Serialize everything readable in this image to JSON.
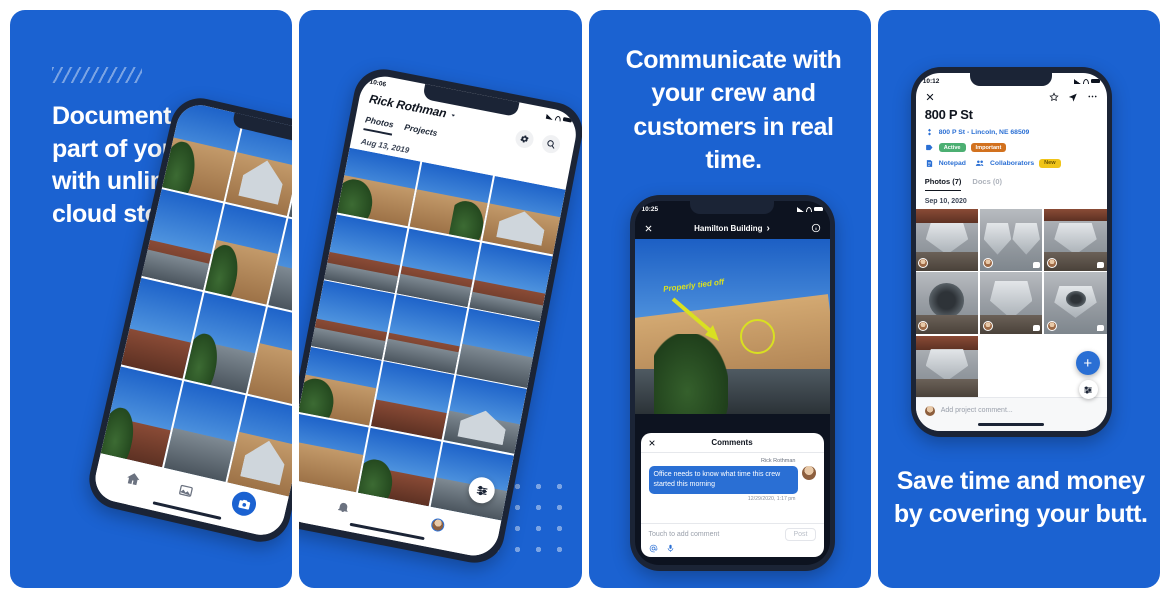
{
  "theme": {
    "brand_blue": "#1B62D1",
    "accent_blue": "#2A6FD4",
    "dark_navy": "#1B2436",
    "annotation_yellow": "#D9E021"
  },
  "panels": [
    {
      "id": "panel-1",
      "headline": "Document every part of your jobs with unlimited cloud storage.",
      "phone": {
        "nav": {
          "home": "home-icon",
          "gallery": "gallery-icon",
          "camera": "camera-button"
        }
      }
    },
    {
      "id": "panel-2",
      "phone": {
        "status": {
          "time": "10:06"
        },
        "user_name": "Rick Rothman",
        "tools": {
          "settings": "gear-icon",
          "search": "search-icon"
        },
        "tabs": [
          {
            "label": "Photos",
            "active": true
          },
          {
            "label": "Projects",
            "active": false
          }
        ],
        "date_header": "Aug 13, 2019",
        "filter": "filter-button",
        "nav": {
          "bell": "bell-icon",
          "avatar": "user-avatar"
        }
      }
    },
    {
      "id": "panel-3",
      "headline": "Communicate with your crew and customers in real time.",
      "phone": {
        "status": {
          "time": "10:25"
        },
        "topbar": {
          "close": "close-icon",
          "title": "Hamilton Building",
          "chevron": "›",
          "info": "info-icon"
        },
        "photo_annotation": "Properly tied off",
        "comments": {
          "title": "Comments",
          "close": "close-icon",
          "author": "Rick Rothman",
          "message": "Office needs to know what time this crew started this morning",
          "timestamp": "12/29/2020, 1:17 pm",
          "input_placeholder": "Touch to add comment",
          "post_label": "Post",
          "icons": [
            "mention-icon",
            "microphone-icon"
          ]
        }
      }
    },
    {
      "id": "panel-4",
      "headline": "Save time and money by covering your butt.",
      "phone": {
        "status": {
          "time": "10:12"
        },
        "actions": {
          "close": "close-icon",
          "star": "star-icon",
          "share": "send-icon",
          "more": "more-icon"
        },
        "title": "800 P St",
        "address": "800 P St - Lincoln, NE 68509",
        "tags": [
          {
            "label": "Active",
            "color": "#4CAF72"
          },
          {
            "label": "Important",
            "color": "#D2711E"
          }
        ],
        "notepad_label": "Notepad",
        "collaborators_label": "Collaborators",
        "new_badge": "New",
        "tabs": [
          {
            "label": "Photos (7)",
            "active": true
          },
          {
            "label": "Docs (0)",
            "active": false
          }
        ],
        "date_header": "Sep 10, 2020",
        "comment_placeholder": "Add project comment...",
        "fab_add": "+",
        "fab_filter": "filter-button"
      }
    }
  ]
}
